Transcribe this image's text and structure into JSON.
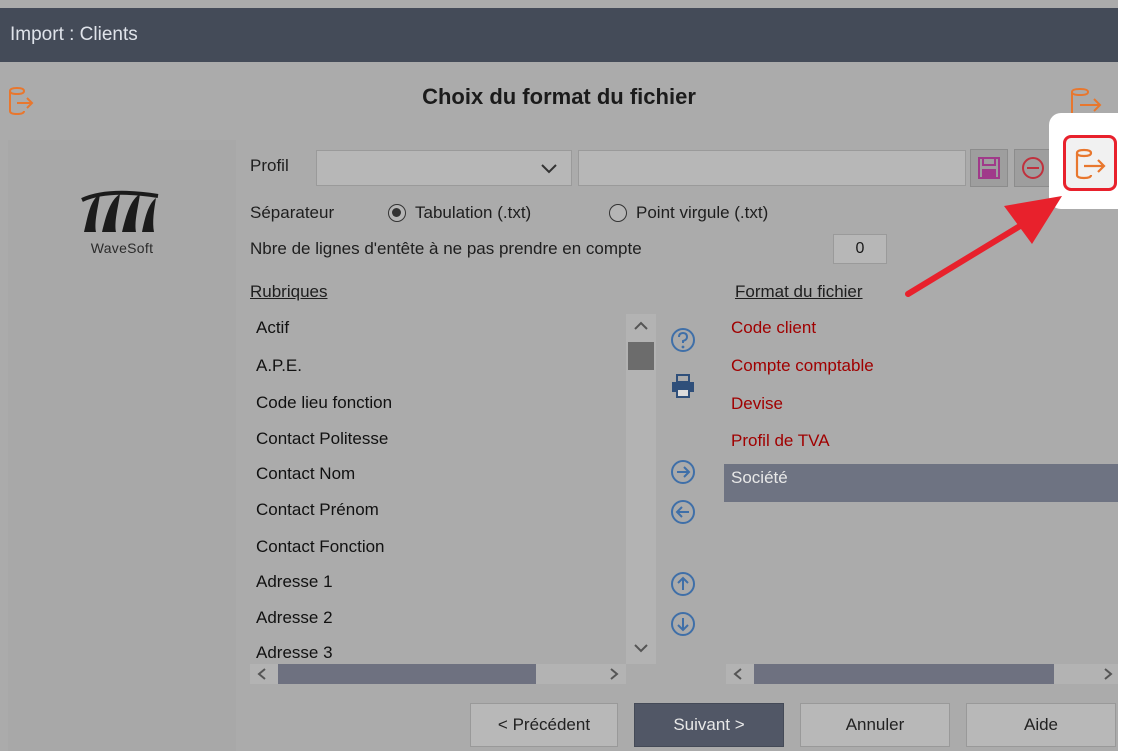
{
  "window": {
    "title": "Import : Clients"
  },
  "header": {
    "page_title": "Choix du format du fichier"
  },
  "logo": {
    "brand": "WaveSoft"
  },
  "profile": {
    "label": "Profil",
    "selected": "",
    "name_value": ""
  },
  "separator": {
    "label": "Séparateur",
    "options": [
      {
        "label": "Tabulation (.txt)",
        "selected": true
      },
      {
        "label": "Point virgule (.txt)",
        "selected": false
      }
    ]
  },
  "header_lines": {
    "label": "Nbre de lignes d'entête à ne pas prendre en compte",
    "value": "0"
  },
  "rubriques": {
    "title": "Rubriques",
    "items": [
      "Actif",
      "A.P.E.",
      "Code lieu fonction",
      "Contact Politesse",
      "Contact Nom",
      "Contact Prénom",
      "Contact Fonction",
      "Adresse 1",
      "Adresse 2",
      "Adresse 3"
    ]
  },
  "format": {
    "title": "Format du fichier",
    "items": [
      "Code client",
      "Compte comptable",
      "Devise",
      "Profil de TVA"
    ],
    "selected_item": "Société"
  },
  "buttons": {
    "previous": "< Précédent",
    "next": "Suivant >",
    "cancel": "Annuler",
    "help": "Aide"
  },
  "colors": {
    "titlebar": "#444b58",
    "background": "#ababab",
    "mandatory_text": "#a00000",
    "icon_orange": "#e8772e",
    "icon_blue": "#3f6fa8",
    "highlight_red": "#e8212c"
  }
}
